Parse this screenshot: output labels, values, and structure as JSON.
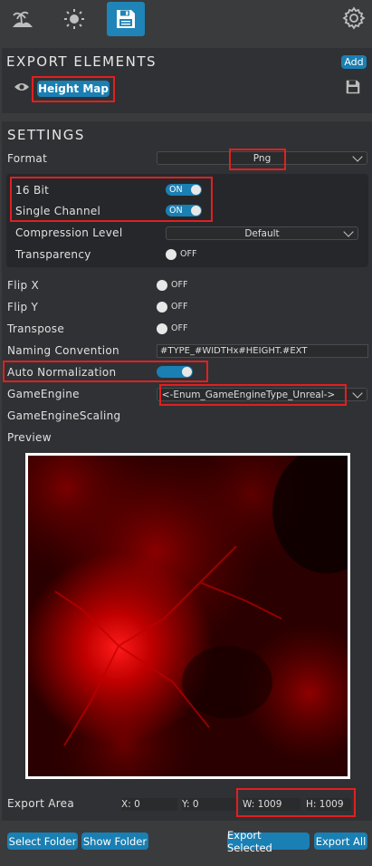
{
  "toolbar": {
    "tabs": [
      {
        "icon": "island-icon",
        "active": false
      },
      {
        "icon": "sun-icon",
        "active": false
      },
      {
        "icon": "save-disk-icon",
        "active": true
      }
    ],
    "settings_icon": "gear-icon"
  },
  "export_elements": {
    "title": "EXPORT ELEMENTS",
    "add_label": "Add",
    "items": [
      {
        "label": "Height Map",
        "visibility_icon": "eye-icon",
        "save_icon": "save-disk-icon"
      }
    ]
  },
  "settings": {
    "title": "SETTINGS",
    "format": {
      "label": "Format",
      "value": "Png"
    },
    "bit16": {
      "label": "16 Bit",
      "state": "ON"
    },
    "single_channel": {
      "label": "Single Channel",
      "state": "ON"
    },
    "compression": {
      "label": "Compression Level",
      "value": "Default"
    },
    "transparency": {
      "label": "Transparency",
      "state": "OFF"
    },
    "flip_x": {
      "label": "Flip X",
      "state": "OFF"
    },
    "flip_y": {
      "label": "Flip Y",
      "state": "OFF"
    },
    "transpose": {
      "label": "Transpose",
      "state": "OFF"
    },
    "naming": {
      "label": "Naming Convention",
      "value": "#TYPE_#WIDTHx#HEIGHT.#EXT"
    },
    "auto_normalization": {
      "label": "Auto Normalization",
      "state": "on"
    },
    "game_engine": {
      "label": "GameEngine",
      "value": "<-Enum_GameEngineType_Unreal->"
    },
    "game_engine_scaling": {
      "label": "GameEngineScaling"
    },
    "preview": {
      "label": "Preview"
    }
  },
  "export_area": {
    "label": "Export Area",
    "x_label": "X:",
    "x_value": "0",
    "y_label": "Y:",
    "y_value": "0",
    "w_label": "W:",
    "w_value": "1009",
    "h_label": "H:",
    "h_value": "1009"
  },
  "footer": {
    "select_folder": "Select Folder",
    "show_folder": "Show Folder",
    "export_selected": "Export Selected",
    "export_all": "Export All"
  },
  "colors": {
    "accent": "#1a7fb3",
    "highlight": "#e02020",
    "panel": "#303134",
    "background": "#3a3b3d"
  }
}
